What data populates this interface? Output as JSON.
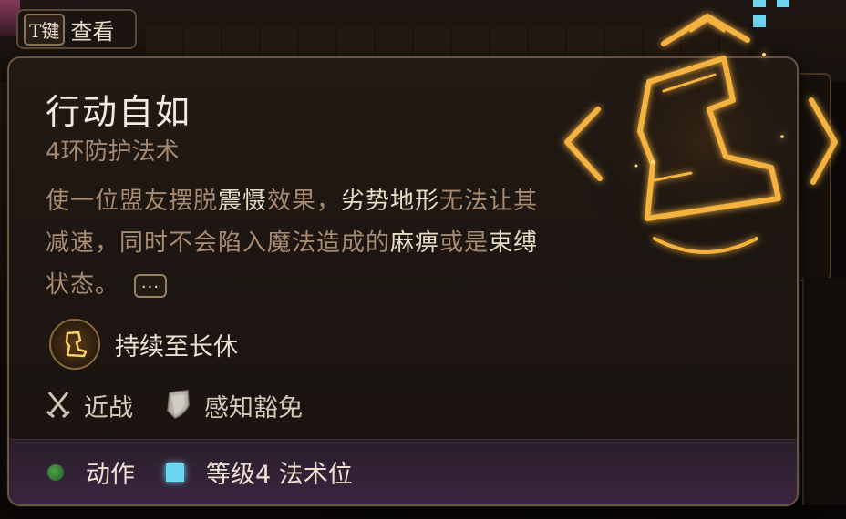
{
  "hint": {
    "key": "T键",
    "label": "查看"
  },
  "spell": {
    "name": "行动自如",
    "level_school": "4环防护法术",
    "description": {
      "p1": "使一位盟友摆脱",
      "hl1": "震慑",
      "p2": "效果，",
      "hl2": "劣势地形",
      "p3": "无法让其减速，同时不会陷入魔法造成的",
      "hl3": "麻痹",
      "p4": "或是",
      "hl4": "束缚",
      "p5": "状态。"
    },
    "more_label": "...",
    "duration": "持续至长休",
    "tags": [
      {
        "icon": "crossed-swords-icon",
        "label": "近战"
      },
      {
        "icon": "shield-icon",
        "label": "感知豁免"
      }
    ],
    "costs": [
      {
        "icon": "action-dot-icon",
        "label": "动作",
        "color": "#3f8f3c"
      },
      {
        "icon": "spell-slot-icon",
        "label": "等级4 法术位",
        "color": "#6ad8f2"
      }
    ]
  },
  "colors": {
    "accent_gold": "#f0b040",
    "highlight_text": "#e8dcc4",
    "body_text": "#a88c72",
    "spell_slot": "#6ad8f2"
  }
}
